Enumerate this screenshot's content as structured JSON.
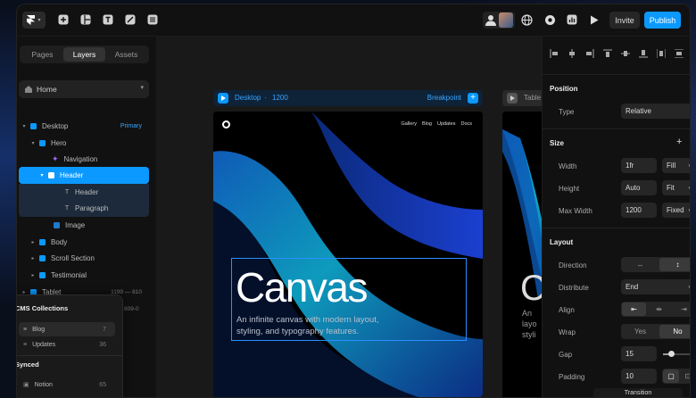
{
  "topbar": {
    "invite_label": "Invite",
    "publish_label": "Publish"
  },
  "left_panel": {
    "tabs": [
      "Pages",
      "Layers",
      "Assets"
    ],
    "page_select": "Home",
    "layers": {
      "desktop": "Desktop",
      "primary_badge": "Primary",
      "hero": "Hero",
      "navigation": "Navigation",
      "header": "Header",
      "header_text": "Header",
      "paragraph": "Paragraph",
      "image": "Image",
      "body": "Body",
      "scroll_section": "Scroll Section",
      "testimonial": "Testimonial",
      "tablet": "Tablet",
      "tablet_range": "1199 — 810",
      "phone_range": "809-0"
    }
  },
  "cms": {
    "title": "CMS Collections",
    "items": [
      {
        "label": "Blog",
        "count": "7"
      },
      {
        "label": "Updates",
        "count": "36"
      }
    ],
    "synced_title": "Synced",
    "synced_items": [
      {
        "label": "Notion",
        "count": "65"
      }
    ]
  },
  "canvas": {
    "desktop_label": "Desktop",
    "desktop_width": "1200",
    "breakpoint_label": "Breakpoint",
    "tablet_label": "Table",
    "nav_links": [
      "Gallery",
      "Blog",
      "Updates",
      "Docs"
    ],
    "hero_title": "Canvas",
    "hero_sub_line1": "An infinite canvas with modern layout,",
    "hero_sub_line2": "styling, and typography features.",
    "tablet_title": "C",
    "tablet_sub_lines": [
      "An",
      "layo",
      "styli"
    ]
  },
  "right_panel": {
    "position": {
      "title": "Position",
      "type_label": "Type",
      "type_value": "Relative"
    },
    "size": {
      "title": "Size",
      "width_label": "Width",
      "width_value": "1fr",
      "width_mode": "Fill",
      "height_label": "Height",
      "height_value": "Auto",
      "height_mode": "Fit",
      "maxwidth_label": "Max Width",
      "maxwidth_value": "1200",
      "maxwidth_mode": "Fixed"
    },
    "layout": {
      "title": "Layout",
      "direction_label": "Direction",
      "distribute_label": "Distribute",
      "distribute_value": "End",
      "align_label": "Align",
      "wrap_label": "Wrap",
      "wrap_yes": "Yes",
      "wrap_no": "No",
      "gap_label": "Gap",
      "gap_value": "15",
      "padding_label": "Padding",
      "padding_value": "10"
    },
    "transition_label": "Transition"
  },
  "colors": {
    "accent": "#0b99ff",
    "panel": "#111111",
    "canvas": "#191919"
  }
}
